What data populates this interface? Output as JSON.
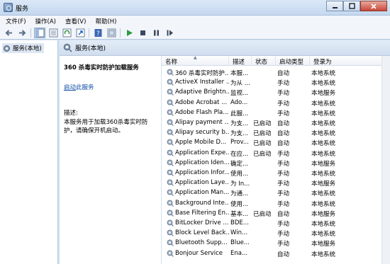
{
  "window": {
    "title": "服务"
  },
  "menu": [
    "文件(F)",
    "操作(A)",
    "查看(V)",
    "帮助(H)"
  ],
  "toolbar": [
    "back-arrow",
    "forward-arrow",
    "console-tree",
    "list-view",
    "refresh",
    "export-list",
    "help",
    "properties",
    "start-service",
    "stop-service",
    "pause-service",
    "restart-service"
  ],
  "tree": {
    "label": "服务(本地)"
  },
  "pane": {
    "header": "服务(本地)"
  },
  "details": {
    "title": "360 杀毒实时防护加载服务",
    "start_link": "启动",
    "start_suffix": "此服务",
    "desc_label": "描述:",
    "desc_text": "本服务用于加载360杀毒实时防护，请确保开机启动。"
  },
  "columns": {
    "name": "名称",
    "desc": "描述",
    "status": "状态",
    "startup": "启动类型",
    "logon": "登录为"
  },
  "services": [
    {
      "name": "360 杀毒实时防护...",
      "desc": "本服...",
      "status": "",
      "startup": "自动",
      "logon": "本地系统"
    },
    {
      "name": "ActiveX Installer ...",
      "desc": "为从 ...",
      "status": "",
      "startup": "手动",
      "logon": "本地系统"
    },
    {
      "name": "Adaptive Brightn...",
      "desc": "监视...",
      "status": "",
      "startup": "手动",
      "logon": "本地服务"
    },
    {
      "name": "Adobe Acrobat ...",
      "desc": "Ado...",
      "status": "",
      "startup": "手动",
      "logon": "本地系统"
    },
    {
      "name": "Adobe Flash Pla...",
      "desc": "此服...",
      "status": "",
      "startup": "手动",
      "logon": "本地系统"
    },
    {
      "name": "Alipay payment ...",
      "desc": "为支...",
      "status": "已启动",
      "startup": "自动",
      "logon": "本地系统"
    },
    {
      "name": "Alipay security b...",
      "desc": "为支...",
      "status": "已启动",
      "startup": "自动",
      "logon": "本地系统"
    },
    {
      "name": "Apple Mobile D...",
      "desc": "Prov...",
      "status": "已启动",
      "startup": "自动",
      "logon": "本地系统"
    },
    {
      "name": "Application Expe...",
      "desc": "在应...",
      "status": "已启动",
      "startup": "手动",
      "logon": "本地系统"
    },
    {
      "name": "Application Iden...",
      "desc": "确定...",
      "status": "",
      "startup": "手动",
      "logon": "本地服务"
    },
    {
      "name": "Application Infor...",
      "desc": "使用...",
      "status": "",
      "startup": "手动",
      "logon": "本地系统"
    },
    {
      "name": "Application Laye...",
      "desc": "为 In...",
      "status": "",
      "startup": "手动",
      "logon": "本地服务"
    },
    {
      "name": "Application Man...",
      "desc": "为通...",
      "status": "",
      "startup": "手动",
      "logon": "本地系统"
    },
    {
      "name": "Background Inte...",
      "desc": "使用...",
      "status": "",
      "startup": "手动",
      "logon": "本地系统"
    },
    {
      "name": "Base Filtering En...",
      "desc": "基本...",
      "status": "已启动",
      "startup": "自动",
      "logon": "本地服务"
    },
    {
      "name": "BitLocker Drive ...",
      "desc": "BDE...",
      "status": "",
      "startup": "手动",
      "logon": "本地系统"
    },
    {
      "name": "Block Level Back...",
      "desc": "Win...",
      "status": "",
      "startup": "手动",
      "logon": "本地系统"
    },
    {
      "name": "Bluetooth Supp...",
      "desc": "Blue...",
      "status": "",
      "startup": "手动",
      "logon": "本地服务"
    },
    {
      "name": "Bonjour Service",
      "desc": "Ena...",
      "status": "",
      "startup": "自动",
      "logon": "本地系统"
    }
  ]
}
